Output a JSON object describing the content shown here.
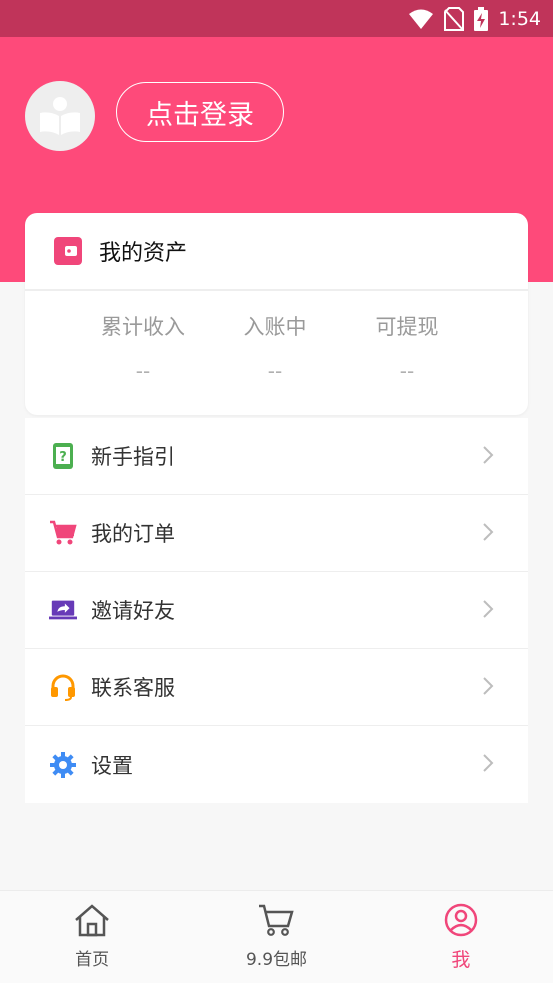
{
  "status_bar": {
    "time": "1:54",
    "icons": [
      "wifi-icon",
      "no-sim-icon",
      "battery-charging-icon"
    ]
  },
  "header": {
    "login_label": "点击登录",
    "avatar_icon": "reading-person-icon"
  },
  "assets": {
    "title": "我的资产",
    "stats": [
      {
        "label": "累计收入",
        "value": "--"
      },
      {
        "label": "入账中",
        "value": "--"
      },
      {
        "label": "可提现",
        "value": "--"
      }
    ]
  },
  "menu": [
    {
      "label": "新手指引",
      "icon": "phone-help-icon",
      "color": "#4caf50"
    },
    {
      "label": "我的订单",
      "icon": "cart-icon",
      "color": "#f0467a"
    },
    {
      "label": "邀请好友",
      "icon": "share-laptop-icon",
      "color": "#673ab7"
    },
    {
      "label": "联系客服",
      "icon": "headset-icon",
      "color": "#ff9800"
    },
    {
      "label": "设置",
      "icon": "gear-icon",
      "color": "#3f8cf4"
    }
  ],
  "tabbar": {
    "active_color": "#f0467a",
    "tabs": [
      {
        "label": "首页",
        "icon": "home-icon"
      },
      {
        "label": "9.9包邮",
        "icon": "cart-icon"
      },
      {
        "label": "我",
        "icon": "user-icon"
      }
    ]
  }
}
